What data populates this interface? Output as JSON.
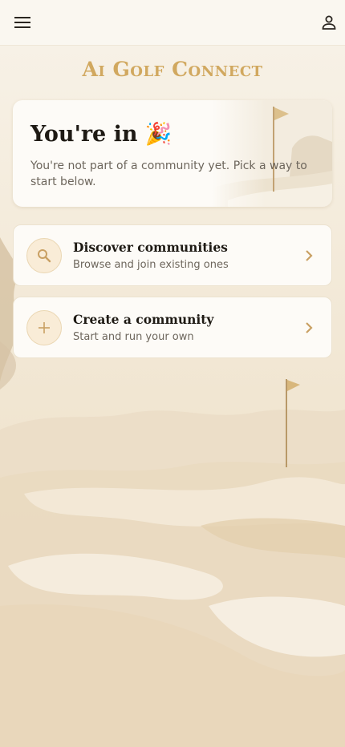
{
  "header": {
    "menu_icon": "menu-icon",
    "profile_icon": "person-icon"
  },
  "app": {
    "title": "Ai Golf Connect"
  },
  "hero": {
    "title": "You're in 🎉",
    "message": "You're not part of a community yet. Pick a way to start below."
  },
  "options": [
    {
      "title": "Discover communities",
      "subtitle": "Browse and join existing ones",
      "icon": "search-icon"
    },
    {
      "title": "Create a community",
      "subtitle": "Start and run your own",
      "icon": "plus-icon"
    }
  ],
  "colors": {
    "accent": "#d1a85f",
    "background": "#f6efe2",
    "card": "#fdfbf7",
    "text": "#1e1a14",
    "muted": "#6d665c"
  }
}
